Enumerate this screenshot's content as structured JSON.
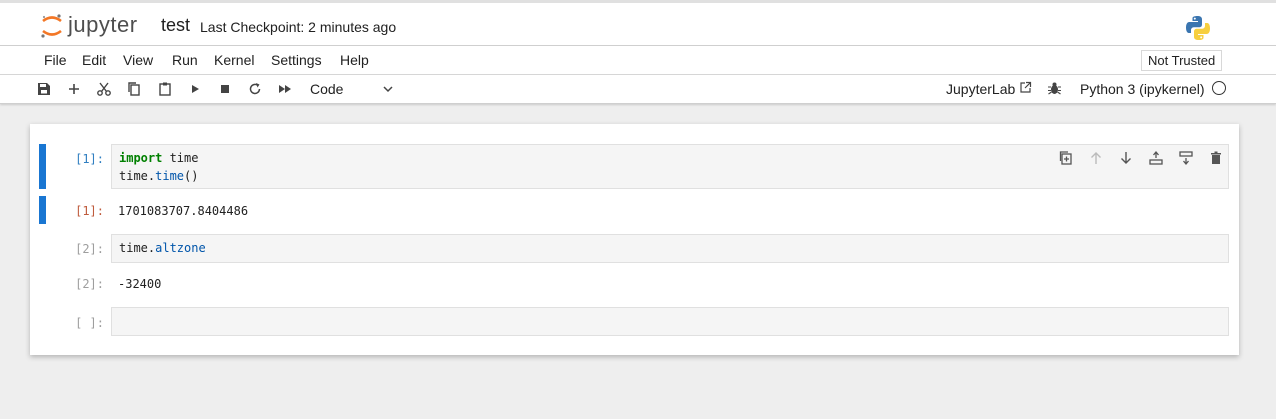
{
  "header": {
    "logo_text": "jupyter",
    "notebook_title": "test",
    "checkpoint": "Last Checkpoint: 2 minutes ago"
  },
  "menu": {
    "items": [
      "File",
      "Edit",
      "View",
      "Run",
      "Kernel",
      "Settings",
      "Help"
    ],
    "trusted_label": "Not Trusted"
  },
  "toolbar": {
    "icons": [
      "save-icon",
      "add-icon",
      "cut-icon",
      "copy-icon",
      "paste-icon",
      "run-icon",
      "stop-icon",
      "restart-icon",
      "fast-forward-icon"
    ],
    "cell_type": "Code",
    "jupyterlab_label": "JupyterLab",
    "kernel_name": "Python 3 (ipykernel)"
  },
  "cells": [
    {
      "in_prompt": "[1]:",
      "code_lines": [
        [
          {
            "t": "import",
            "c": "kw"
          },
          {
            "t": " time",
            "c": ""
          }
        ],
        [
          {
            "t": "time.",
            "c": ""
          },
          {
            "t": "time",
            "c": "fn"
          },
          {
            "t": "()",
            "c": ""
          }
        ]
      ],
      "out_prompt": "[1]:",
      "output": "1701083707.8404486"
    },
    {
      "in_prompt": "[2]:",
      "code_lines": [
        [
          {
            "t": "time.",
            "c": ""
          },
          {
            "t": "altzone",
            "c": "fn"
          }
        ]
      ],
      "out_prompt": "[2]:",
      "output": "-32400"
    },
    {
      "in_prompt": "[ ]:",
      "code_lines": []
    }
  ],
  "cell_toolbar_icons": [
    "duplicate-icon",
    "move-up-icon",
    "move-down-icon",
    "insert-above-icon",
    "insert-below-icon",
    "delete-icon"
  ],
  "colors": {
    "accent": "#1976d2",
    "in_prompt": "#307fc1",
    "out_prompt": "#bf5b3d",
    "logo_orange": "#f37726"
  }
}
